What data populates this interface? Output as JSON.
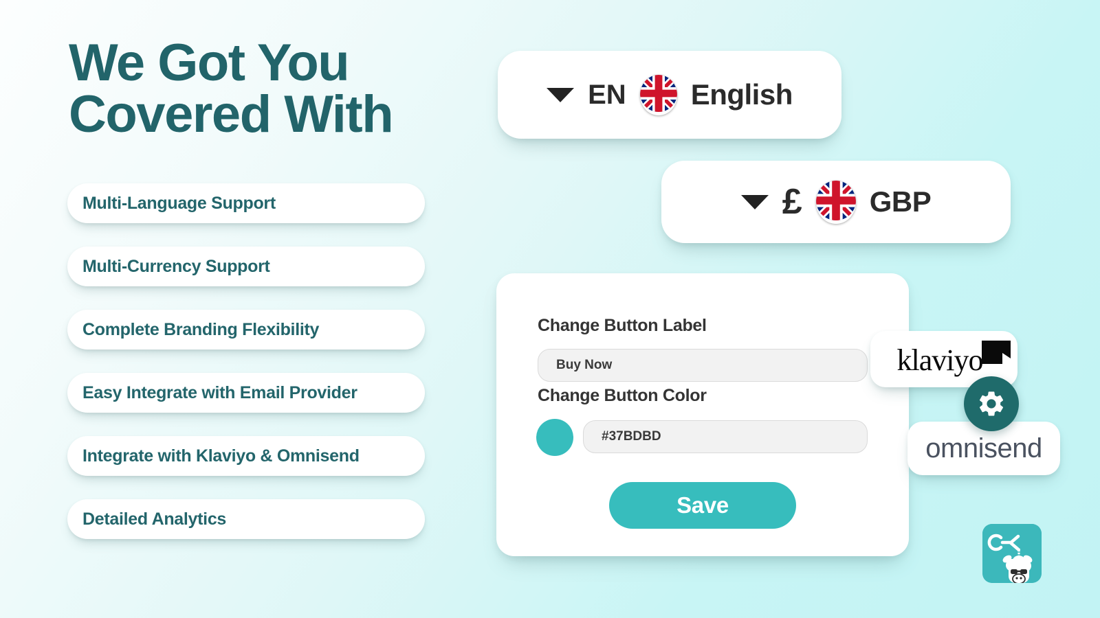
{
  "theme": {
    "heading_color": "#22646a",
    "pill_text_color": "#23656b",
    "accent_teal": "#37bdbd",
    "dark_teal": "#1f6b6b",
    "bg_from": "#fcfefe",
    "bg_to": "#c2f3f4"
  },
  "heading": {
    "title": "We Got You\nCovered With"
  },
  "features": [
    {
      "label": "Multi-Language Support"
    },
    {
      "label": "Multi-Currency Support"
    },
    {
      "label": "Complete Branding Flexibility"
    },
    {
      "label": "Easy Integrate with Email Provider"
    },
    {
      "label": "Integrate with Klaviyo & Omnisend"
    },
    {
      "label": "Detailed Analytics"
    }
  ],
  "language_selector": {
    "caret_icon": "chevron-down-icon",
    "code": "EN",
    "flag_icon": "uk-flag-icon",
    "name": "English"
  },
  "currency_selector": {
    "caret_icon": "chevron-down-icon",
    "symbol": "£",
    "flag_icon": "uk-flag-icon",
    "code": "GBP"
  },
  "settings_card": {
    "button_label_heading": "Change Button Label",
    "button_label_value": "Buy Now",
    "button_label_placeholder": "Buy Now",
    "button_color_heading": "Change Button Color",
    "button_color_value": "#37BDBD",
    "button_color_placeholder": "#37BDBD",
    "swatch_color": "#37bdbd",
    "save_label": "Save",
    "save_color": "#37bdbd"
  },
  "integrations": {
    "klaviyo_name": "klaviyo",
    "klaviyo_icon": "klaviyo-flag-icon",
    "omnisend_name": "omnisend",
    "gear_icon": "gear-icon"
  },
  "app_logo": {
    "icon": "app-logo-unicorn-icon"
  }
}
